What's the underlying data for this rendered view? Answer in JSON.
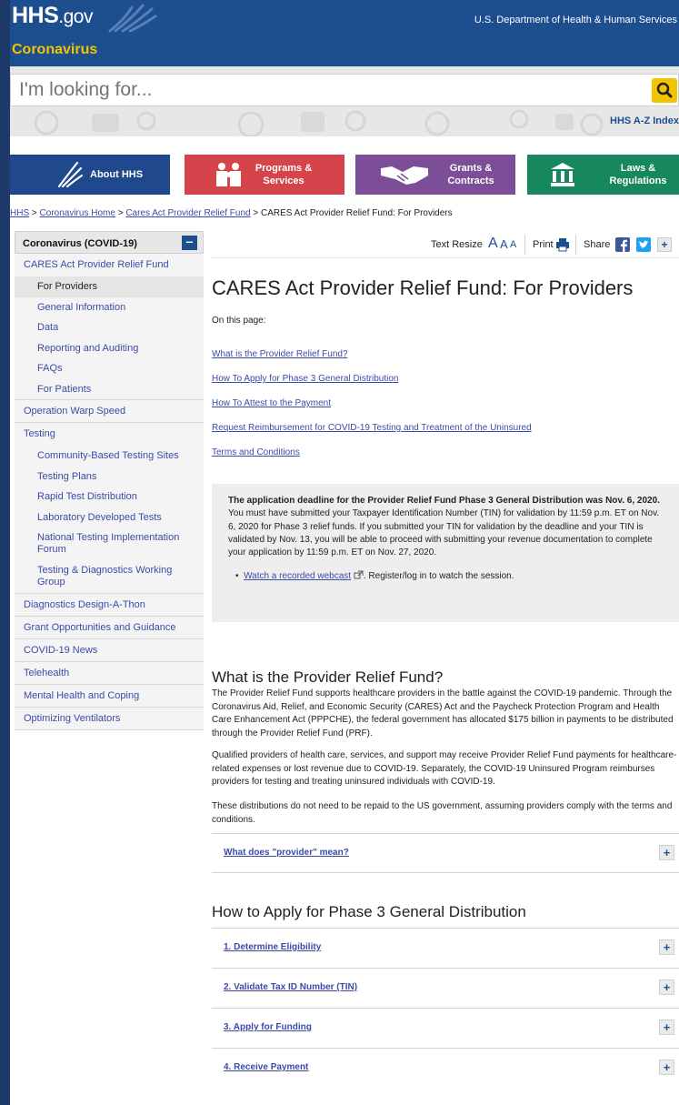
{
  "header": {
    "logo_main": "HHS",
    "logo_suffix": ".gov",
    "subbrand": "Coronavirus",
    "department": "U.S. Department of Health & Human Services"
  },
  "search": {
    "placeholder": "I'm looking for...",
    "az_link": "HHS A-Z Index"
  },
  "nav": {
    "about": "About HHS",
    "programs_line1": "Programs &",
    "programs_line2": "Services",
    "grants_line1": "Grants &",
    "grants_line2": "Contracts",
    "laws_line1": "Laws &",
    "laws_line2": "Regulations"
  },
  "breadcrumb": {
    "hhs": "HHS",
    "sep": ">",
    "coronavirus_home": "Coronavirus Home",
    "cares": "Cares Act Provider Relief Fund",
    "current": "CARES Act Provider Relief Fund: For Providers"
  },
  "sidebar": {
    "heading": "Coronavirus (COVID-19)",
    "collapse_symbol": "−",
    "cares": "CARES Act Provider Relief Fund",
    "cares_sub": [
      "For Providers",
      "General Information",
      "Data",
      "Reporting and Auditing",
      "FAQs",
      "For Patients"
    ],
    "warp": "Operation Warp Speed",
    "testing": "Testing",
    "testing_sub_1": [
      "Community-Based Testing Sites",
      "Testing Plans",
      "Rapid Test Distribution",
      "Laboratory Developed Tests"
    ],
    "testing_sub_national": "National Testing Implementation Forum",
    "testing_sub_working": "Testing & Diagnostics Working Group",
    "rest": [
      "Diagnostics Design-A-Thon",
      "Grant Opportunities and Guidance",
      "COVID-19 News",
      "Telehealth",
      "Mental Health and Coping",
      "Optimizing Ventilators"
    ]
  },
  "toolbar": {
    "text_resize": "Text Resize",
    "a_large": "A",
    "a_mid": "A",
    "a_small": "A",
    "print": "Print",
    "share": "Share"
  },
  "main": {
    "title": "CARES Act Provider Relief Fund: For Providers",
    "on_this_page": "On this page:",
    "toc": [
      "What is the Provider Relief Fund?",
      "How To Apply for Phase 3 General Distribution",
      "How To Attest to the Payment",
      "Request Reimbursement for COVID-19 Testing and Treatment of the Uninsured",
      "Terms and Conditions"
    ],
    "callout_bold": "The application deadline for the Provider Relief Fund Phase 3 General Distribution was Nov. 6, 2020.",
    "callout_text": " You must have submitted your Taxpayer Identification Number (TIN) for validation by 11:59 p.m. ET on Nov. 6, 2020 for Phase 3 relief funds. If you submitted your TIN for validation by the deadline and your TIN is validated by Nov. 13, you will be able to proceed with submitting your revenue documentation to complete your application by 11:59 p.m. ET on Nov. 27, 2020.",
    "webcast_link": "Watch a recorded webcast",
    "webcast_text": ". Register/log in to watch the session.",
    "h2_prf": "What is the Provider Relief Fund?",
    "para1": "The Provider Relief Fund supports healthcare providers in the battle against the COVID-19 pandemic. Through the Coronavirus Aid, Relief, and Economic Security (CARES) Act and the Paycheck Protection Program and Health Care Enhancement Act (PPPCHE), the federal government has allocated $175 billion in payments to be distributed through the Provider Relief Fund (PRF).",
    "para2": "Qualified providers of health care, services, and support may receive Provider Relief Fund payments for healthcare-related expenses or lost revenue due to COVID-19. Separately, the COVID-19 Uninsured Program reimburses providers for testing and treating uninsured individuals with COVID-19.",
    "para3": "These distributions do not need to be repaid to the US government, assuming providers comply with the terms and conditions.",
    "provider_acc": "What does \"provider\" mean?",
    "h2_apply": "How to Apply for Phase 3 General Distribution",
    "steps": [
      "1. Determine Eligibility",
      "2. Validate Tax ID Number (TIN)",
      "3. Apply for Funding",
      "4. Receive Payment"
    ],
    "plus": "+"
  }
}
